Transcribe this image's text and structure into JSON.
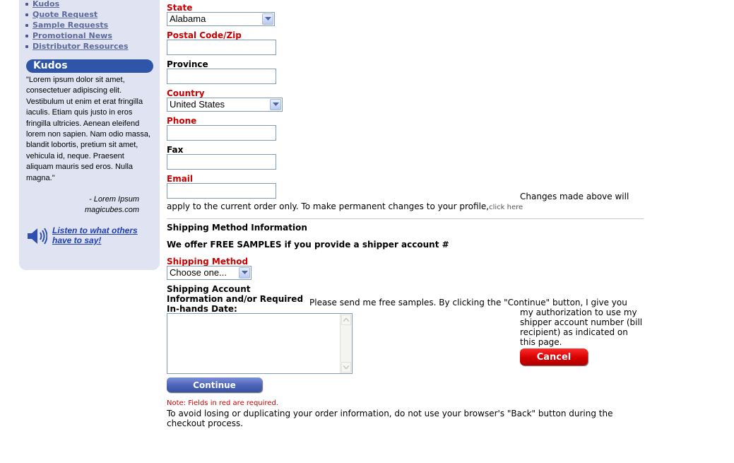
{
  "sidebar": {
    "nav": [
      {
        "label": "Kudos"
      },
      {
        "label": "Quote Request"
      },
      {
        "label": "Sample Requests"
      },
      {
        "label": "Promotional News"
      },
      {
        "label": "Distributor Resources"
      }
    ],
    "kudos_title": "Kudos",
    "kudos_quote": "\"Lorem ipsum dolor sit amet, consectetuer adipiscing elit. Vestibulum ut enim et erat fringilla iaculis. Etiam quis justo in eros fringilla ultricies. Aenean eleifend lorem non sapien. Nam odio massa, blandit lobortis, pretium sit amet, vehicula id, neque. Praesent aliquam mauris sed eros. Nulla magna.\"",
    "kudos_author": "- Lorem Ipsum",
    "kudos_site": "magicubes.com",
    "listen_link": "Listen to what others have to say!"
  },
  "form": {
    "state_label": "State",
    "state_value": "Alabama",
    "postal_label": "Postal Code/Zip",
    "postal_value": "",
    "province_label": "Province",
    "province_value": "",
    "country_label": "Country",
    "country_value": "United States",
    "phone_label": "Phone",
    "phone_value": "",
    "fax_label": "Fax",
    "fax_value": "",
    "email_label": "Email",
    "email_value": "",
    "changes_note_a": "Changes made above will",
    "changes_note_b": "apply to the current order only. To make permanent changes to your profile,",
    "click_here": "click here"
  },
  "shipping": {
    "section_title": "Shipping Method Information",
    "free_samples": "We offer FREE SAMPLES if you provide a shipper account #",
    "method_label": "Shipping Method",
    "method_value": "Choose one...",
    "account_label": "Shipping Account Information and/or Required In-hands Date:",
    "account_value": "",
    "samples_text_a": "Please send me free samples. By clicking the \"Continue\" button, I give you",
    "samples_text_b": "my authorization to use my shipper account number (bill recipient) as indicated on this page.",
    "cancel_label": "Cancel",
    "continue_label": "Continue"
  },
  "footer": {
    "required_note": "Note: Fields in red are required.",
    "back_warning": "To avoid losing or duplicating your order information, do not use your browser's \"Back\" button during the checkout process."
  },
  "colors": {
    "required": "#cc0000",
    "sidebar_bg": "#dfe3f2",
    "kudos_header": "#2e55a7",
    "cancel_button": "#d40000",
    "continue_button": "#4a63b8"
  },
  "icons": [
    "speaker-icon",
    "chevron-down-icon",
    "scroll-up-icon",
    "scroll-down-icon"
  ]
}
